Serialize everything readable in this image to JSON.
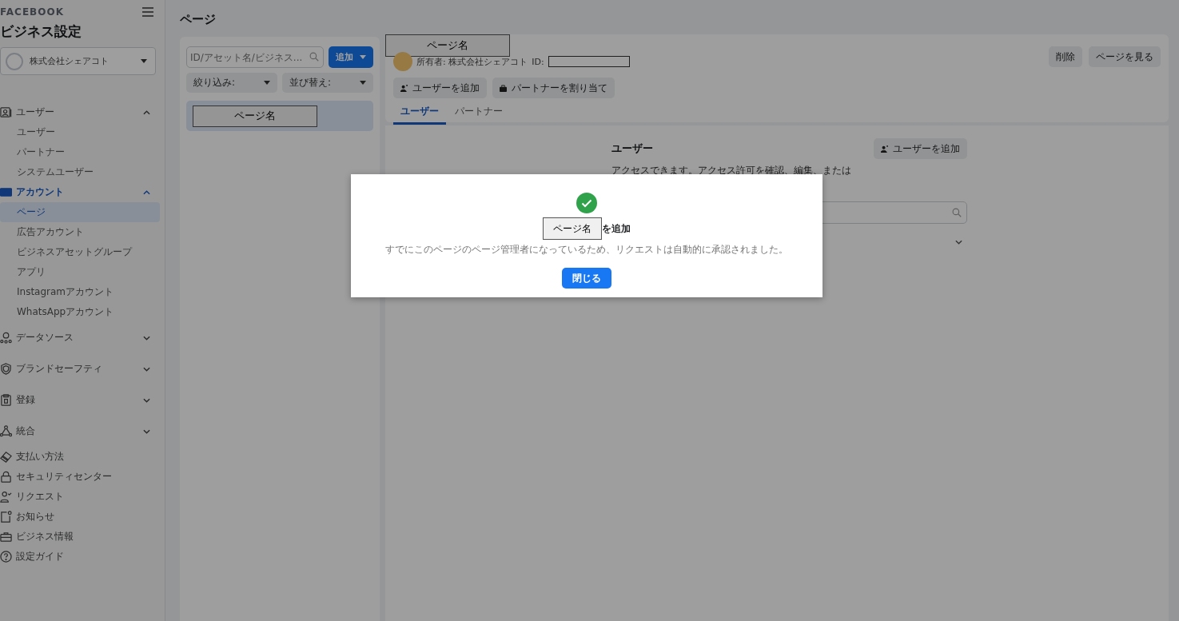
{
  "sidebar": {
    "brand": "FACEBOOK",
    "title": "ビジネス設定",
    "account": "株式会社シェアコト",
    "sections": [
      {
        "kind": "group",
        "label": "ユーザー",
        "expanded": true,
        "selected": false,
        "children": [
          {
            "label": "ユーザー",
            "selected": false
          },
          {
            "label": "パートナー",
            "selected": false
          },
          {
            "label": "システムユーザー",
            "selected": false
          }
        ]
      },
      {
        "kind": "group",
        "label": "アカウント",
        "expanded": true,
        "selected": true,
        "children": [
          {
            "label": "ページ",
            "selected": true
          },
          {
            "label": "広告アカウント",
            "selected": false
          },
          {
            "label": "ビジネスアセットグループ",
            "selected": false
          },
          {
            "label": "アプリ",
            "selected": false
          },
          {
            "label": "Instagramアカウント",
            "selected": false
          },
          {
            "label": "WhatsAppアカウント",
            "selected": false
          }
        ]
      },
      {
        "kind": "group",
        "label": "データソース",
        "expanded": false,
        "selected": false
      },
      {
        "kind": "group",
        "label": "ブランドセーフティ",
        "expanded": false,
        "selected": false
      },
      {
        "kind": "group",
        "label": "登録",
        "expanded": false,
        "selected": false
      },
      {
        "kind": "group",
        "label": "統合",
        "expanded": false,
        "selected": false
      },
      {
        "kind": "link",
        "label": "支払い方法",
        "selected": false
      },
      {
        "kind": "link",
        "label": "セキュリティセンター",
        "selected": false
      },
      {
        "kind": "link",
        "label": "リクエスト",
        "selected": false
      },
      {
        "kind": "link",
        "label": "お知らせ",
        "selected": false
      },
      {
        "kind": "link",
        "label": "ビジネス情報",
        "selected": false
      },
      {
        "kind": "link",
        "label": "設定ガイド",
        "selected": false
      }
    ]
  },
  "page_header": "ページ",
  "list_panel": {
    "search": {
      "placeholder": "ID/アセット名/ビジネス..."
    },
    "add_button": "追加",
    "filter": "絞り込み:",
    "sort": "並び替え:",
    "items": [
      {
        "label": "ページ名",
        "selected": true
      }
    ]
  },
  "detail": {
    "name": "ページ名",
    "owner": "所有者: 株式会社シェアコト",
    "id_label": "ID:",
    "actions": [
      {
        "kind": "user",
        "label": "ユーザーを追加"
      },
      {
        "kind": "partner",
        "label": "パートナーを割り当て"
      }
    ],
    "header_buttons": [
      "削除",
      "ページを見る"
    ],
    "tabs": [
      {
        "label": "ユーザー",
        "selected": true
      },
      {
        "label": "パートナー",
        "selected": false
      }
    ],
    "section_title": "ユーザー",
    "section_button": "ユーザーを追加",
    "description": "アクセスできます。アクセス許可を確認、編集、または"
  },
  "dialog": {
    "name": "ページ名",
    "title_suffix": "を追加",
    "message": "すでにこのページのページ管理者になっているため、リクエストは自動的に承認されました。",
    "button": "閉じる"
  }
}
